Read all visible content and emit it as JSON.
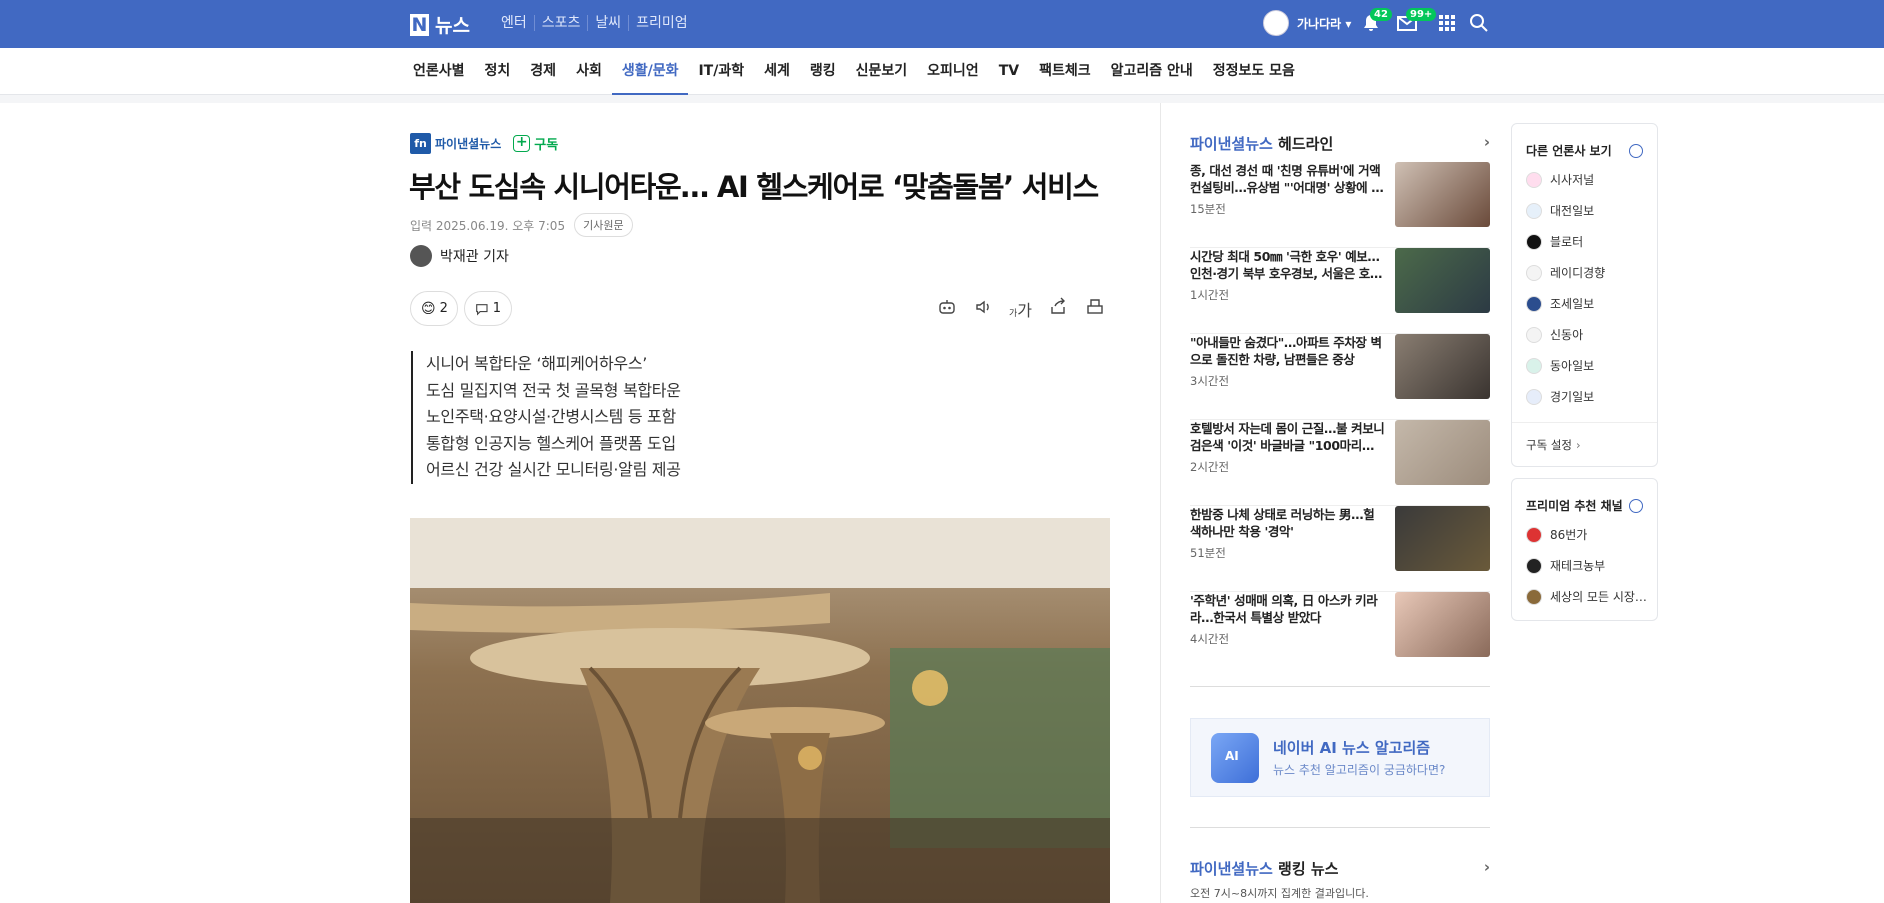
{
  "topbar": {
    "logo_letter": "N",
    "logo_text": "뉴스",
    "links": [
      "엔터",
      "스포츠",
      "날씨",
      "프리미엄"
    ],
    "user_name": "가나다라",
    "notif_count": "42",
    "mail_count": "99+"
  },
  "nav": {
    "items": [
      "언론사별",
      "정치",
      "경제",
      "사회",
      "생활/문화",
      "IT/과학",
      "세계",
      "랭킹",
      "신문보기",
      "오피니언",
      "TV",
      "팩트체크",
      "알고리즘 안내",
      "정정보도 모음"
    ],
    "active": "생활/문화"
  },
  "article": {
    "press_name": "파이낸셜뉴스",
    "subscribe_label": "구독",
    "title": "부산 도심속 시니어타운… AI 헬스케어로 ‘맞춤돌봄’ 서비스",
    "date": "입력 2025.06.19. 오후 7:05",
    "original_label": "기사원문",
    "reporter": "박재관 기자",
    "reaction_count": "2",
    "comment_count": "1",
    "font_size_label": "가",
    "summary": [
      "시니어 복합타운 ‘해피케어하우스’",
      "도심 밀집지역 전국 첫 골목형 복합타운",
      "노인주택·요양시설·간병시스템 등 포함",
      "통합형 인공지능 헬스케어 플랫폼 도입",
      "어르신 건강 실시간 모니터링·알림 제공"
    ]
  },
  "headline_section": {
    "brand": "파이낸셜뉴스",
    "title": "헤드라인",
    "items": [
      {
        "text": "종, 대선 경선 때 '친명 유튜버'에 거액 컨설팅비…유상범 \"'어대명' 상황에 …",
        "time": "15분전"
      },
      {
        "text": "시간당 최대 50㎜ '극한 호우' 예보… 인천·경기 북부 호우경보, 서울은 호…",
        "time": "1시간전"
      },
      {
        "text": "\"아내들만 숨겼다\"…아파트 주차장 벽으로 돌진한 차량, 남편들은 중상",
        "time": "3시간전"
      },
      {
        "text": "호텔방서 자는데 몸이 근질…불 켜보니 검은색 '이것' 바글바글 \"100마리…",
        "time": "2시간전"
      },
      {
        "text": "한밤중 나체 상태로 러닝하는 男…헐색하나만 착용 '경악'",
        "time": "51분전"
      },
      {
        "text": "'주학년' 성매매 의혹, 日 아스카 키라라…한국서 특별상 받았다",
        "time": "4시간전"
      }
    ]
  },
  "ai_box": {
    "title": "네이버 AI 뉴스 알고리즘",
    "subtitle": "뉴스 추천 알고리즘이 궁금하다면?",
    "icon_text": "AI"
  },
  "ranking": {
    "brand": "파이낸셜뉴스",
    "title": "랭킹 뉴스",
    "desc": "오전 7시~8시까지 집계한 결과입니다."
  },
  "other_press": {
    "title": "다른 언론사 보기",
    "items": [
      "시사저널",
      "대전일보",
      "블로터",
      "레이디경향",
      "조세일보",
      "신동아",
      "동아일보",
      "경기일보"
    ],
    "setting_label": "구독 설정"
  },
  "premium": {
    "title": "프리미엄 추천 채널",
    "items": [
      "86번가",
      "재테크농부",
      "세상의 모든 시장…"
    ]
  }
}
